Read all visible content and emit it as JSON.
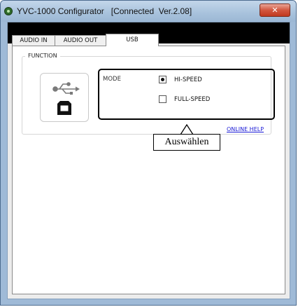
{
  "window": {
    "title": "YVC-1000 Configurator   [Connected  Ver.2.08]",
    "close_glyph": "✕",
    "app_icon": "app-icon"
  },
  "tabs": [
    {
      "label": "AUDIO IN",
      "active": false
    },
    {
      "label": "AUDIO OUT",
      "active": false
    },
    {
      "label": "USB",
      "active": true
    }
  ],
  "function_group": {
    "legend": "FUNCTION",
    "icons": [
      "usb-symbol-icon",
      "usb-b-port-icon"
    ],
    "mode_label": "MODE",
    "options": [
      {
        "label": "HI-SPEED",
        "selected": true
      },
      {
        "label": "FULL-SPEED",
        "selected": false
      }
    ]
  },
  "online_help": "ONLINE HELP",
  "annotation": {
    "callout_text": "Auswählen"
  },
  "colors": {
    "link": "#1a1ad6",
    "close_button": "#c7452b",
    "window_frame": "#9fbad7"
  }
}
